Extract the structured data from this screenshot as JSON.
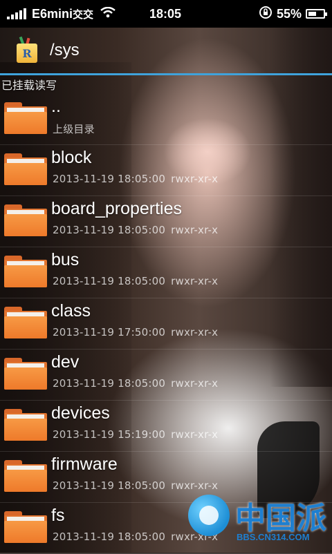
{
  "status_bar": {
    "carrier": "E6mini",
    "carrier_badge": "交交",
    "time": "18:05",
    "battery_percent": "55%",
    "battery_level": 0.55
  },
  "header": {
    "path": "/sys",
    "app_icon_letter": "R"
  },
  "mount_status": "已挂载读写",
  "files": [
    {
      "name": "..",
      "meta": "上级目录",
      "perm": ""
    },
    {
      "name": "block",
      "meta": "2013-11-19 18:05:00",
      "perm": "rwxr-xr-x"
    },
    {
      "name": "board_properties",
      "meta": "2013-11-19 18:05:00",
      "perm": "rwxr-xr-x"
    },
    {
      "name": "bus",
      "meta": "2013-11-19 18:05:00",
      "perm": "rwxr-xr-x"
    },
    {
      "name": "class",
      "meta": "2013-11-19 17:50:00",
      "perm": "rwxr-xr-x"
    },
    {
      "name": "dev",
      "meta": "2013-11-19 18:05:00",
      "perm": "rwxr-xr-x"
    },
    {
      "name": "devices",
      "meta": "2013-11-19 15:19:00",
      "perm": "rwxr-xr-x"
    },
    {
      "name": "firmware",
      "meta": "2013-11-19 18:05:00",
      "perm": "rwxr-xr-x"
    },
    {
      "name": "fs",
      "meta": "2013-11-19 18:05:00",
      "perm": "rwxr-xr-x"
    }
  ],
  "watermark": {
    "text": "中国派",
    "url": "BBS.CN314.COM"
  },
  "colors": {
    "accent": "#3fa3dc",
    "folder": "#ee7a2a"
  }
}
